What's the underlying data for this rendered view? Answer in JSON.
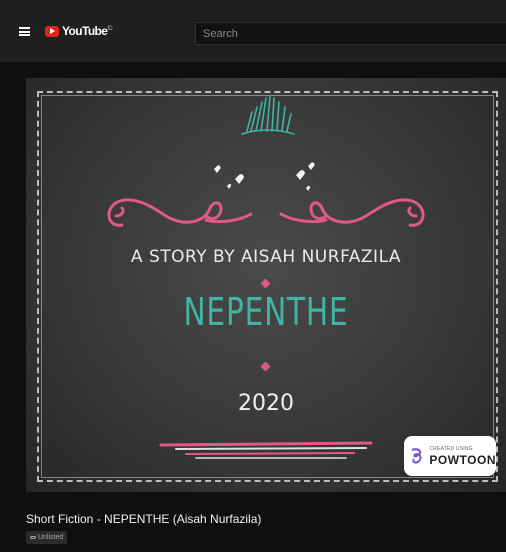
{
  "header": {
    "logo_text": "YouTube",
    "logo_suffix": "ID",
    "search_placeholder": "Search"
  },
  "video": {
    "byline": "A STORY BY AISAH NURFAZILA",
    "title_card": "NEPENTHE",
    "year": "2020",
    "watermark_small": "CREATED USING",
    "watermark_big": "POWTOON",
    "title": "Short Fiction - NEPENTHE (Aisah Nurfazila)",
    "visibility": "Unlisted"
  },
  "colors": {
    "accent_pink": "#e05a86",
    "accent_teal": "#3fb5a2",
    "youtube_red": "#e62117"
  }
}
